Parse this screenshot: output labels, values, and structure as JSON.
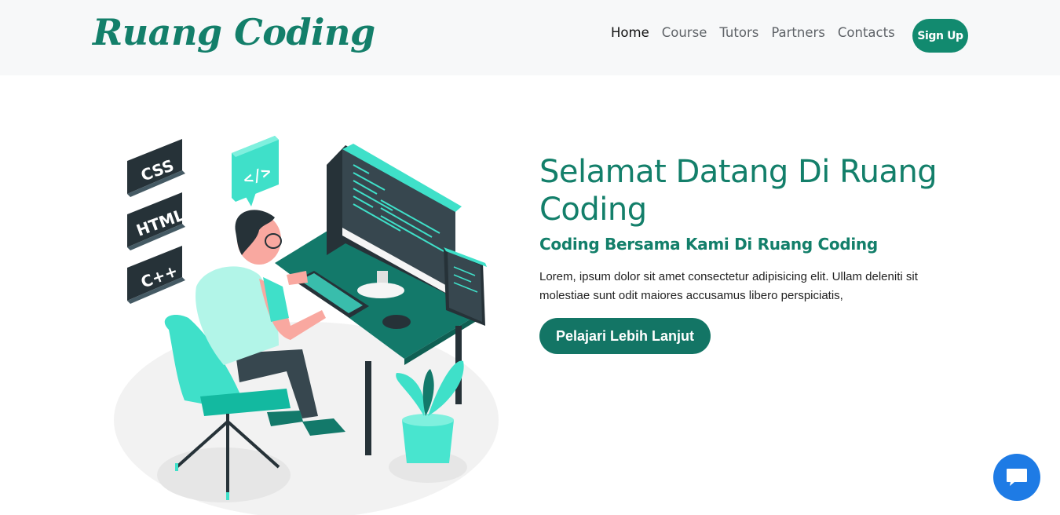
{
  "brand": {
    "name": "Ruang Coding"
  },
  "nav": {
    "items": [
      {
        "label": "Home",
        "active": true
      },
      {
        "label": "Course",
        "active": false
      },
      {
        "label": "Tutors",
        "active": false
      },
      {
        "label": "Partners",
        "active": false
      },
      {
        "label": "Contacts",
        "active": false
      }
    ],
    "signup_label": "Sign Up"
  },
  "hero": {
    "title": "Selamat Datang Di Ruang Coding",
    "subtitle": "Coding Bersama Kami Di Ruang Coding",
    "body": "Lorem, ipsum dolor sit amet consectetur adipisicing elit. Ullam deleniti sit molestiae sunt odit maiores accusamus libero perspiciatis,",
    "cta_label": "Pelajari Lebih Lanjut"
  },
  "illustration": {
    "badges": [
      "CSS",
      "HTML",
      "C++"
    ],
    "code_bubble": "</>"
  },
  "chat": {
    "icon": "chat-icon"
  },
  "colors": {
    "brand_green": "#137f6a",
    "button_green": "#128a6f",
    "accent_teal": "#3fe0c9",
    "chat_blue": "#1e7be5",
    "navbar_bg": "#f7f8f9"
  }
}
